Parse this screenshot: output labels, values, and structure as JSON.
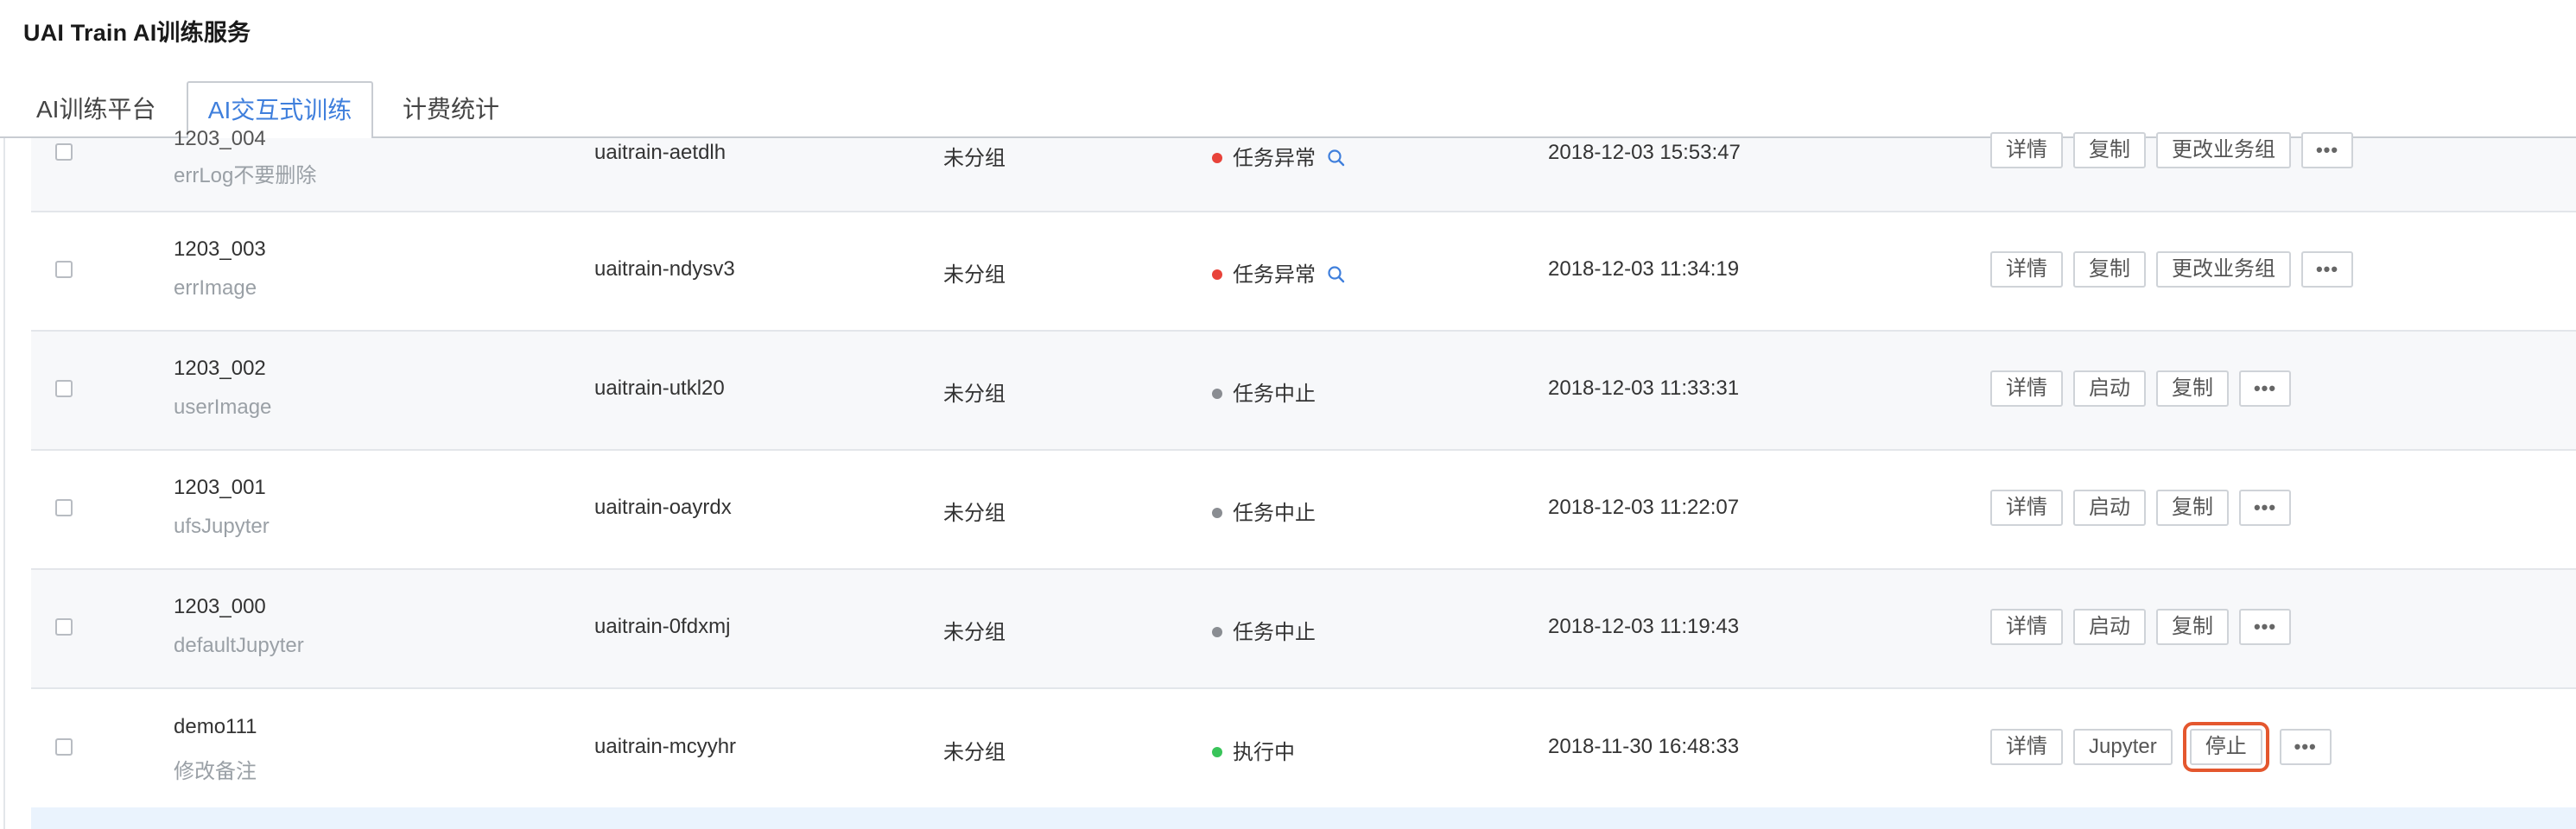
{
  "app": {
    "title": "UAI Train AI训练服务"
  },
  "tabs": [
    {
      "label": "AI训练平台"
    },
    {
      "label": "AI交互式训练"
    },
    {
      "label": "计费统计"
    }
  ],
  "colors": {
    "accent": "#3f7fdc",
    "status_error": "#e8433a",
    "status_stopped": "#8a8d92",
    "status_running": "#39c45a",
    "highlight_outline": "#e4572e"
  },
  "rows": [
    {
      "name": "1203_004",
      "note": "errLog不要删除",
      "id": "uaitrain-aetdlh",
      "group": "未分组",
      "status": "任务异常",
      "time": "2018-12-03 15:53:47",
      "actions": [
        "详情",
        "复制",
        "更改业务组"
      ],
      "more_label": "•••"
    },
    {
      "name": "1203_003",
      "note": "errImage",
      "id": "uaitrain-ndysv3",
      "group": "未分组",
      "status": "任务异常",
      "time": "2018-12-03 11:34:19",
      "actions": [
        "详情",
        "复制",
        "更改业务组"
      ],
      "more_label": "•••"
    },
    {
      "name": "1203_002",
      "note": "userImage",
      "id": "uaitrain-utkl20",
      "group": "未分组",
      "status": "任务中止",
      "time": "2018-12-03 11:33:31",
      "actions": [
        "详情",
        "启动",
        "复制"
      ],
      "more_label": "•••"
    },
    {
      "name": "1203_001",
      "note": "ufsJupyter",
      "id": "uaitrain-oayrdx",
      "group": "未分组",
      "status": "任务中止",
      "time": "2018-12-03 11:22:07",
      "actions": [
        "详情",
        "启动",
        "复制"
      ],
      "more_label": "•••"
    },
    {
      "name": "1203_000",
      "note": "defaultJupyter",
      "id": "uaitrain-0fdxmj",
      "group": "未分组",
      "status": "任务中止",
      "time": "2018-12-03 11:19:43",
      "actions": [
        "详情",
        "启动",
        "复制"
      ],
      "more_label": "•••"
    },
    {
      "name": "demo111",
      "note": "修改备注",
      "id": "uaitrain-mcyyhr",
      "group": "未分组",
      "status": "执行中",
      "time": "2018-11-30 16:48:33",
      "actions": [
        "详情",
        "Jupyter",
        "停止"
      ],
      "more_label": "•••"
    }
  ]
}
